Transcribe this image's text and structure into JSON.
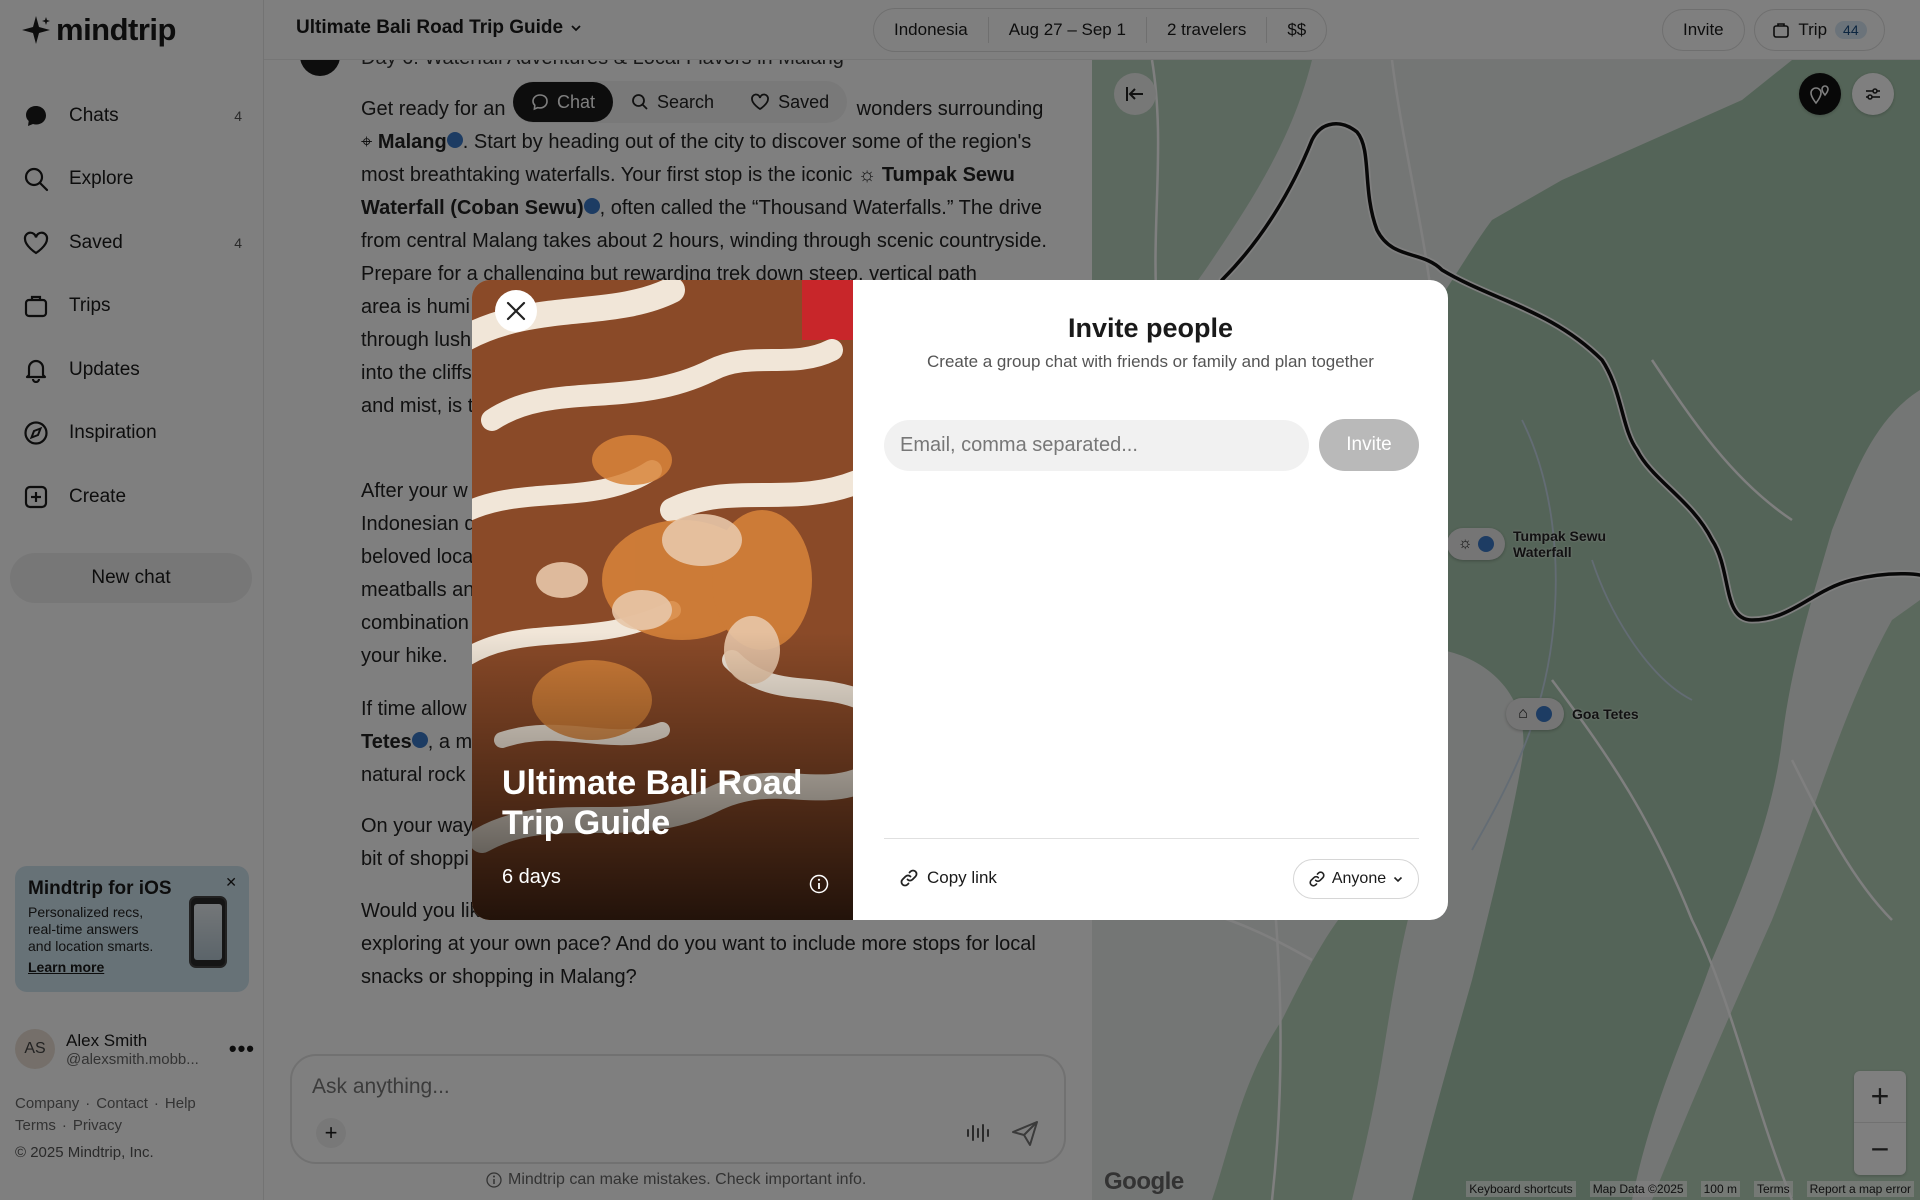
{
  "app": {
    "brand": "mindtrip"
  },
  "sidebar": {
    "items": [
      {
        "label": "Chats",
        "count": "4",
        "icon": "chat-bubble-icon"
      },
      {
        "label": "Explore",
        "count": "",
        "icon": "search-icon"
      },
      {
        "label": "Saved",
        "count": "4",
        "icon": "heart-icon"
      },
      {
        "label": "Trips",
        "count": "",
        "icon": "suitcase-icon"
      },
      {
        "label": "Updates",
        "count": "",
        "icon": "bell-icon"
      },
      {
        "label": "Inspiration",
        "count": "",
        "icon": "compass-icon"
      },
      {
        "label": "Create",
        "count": "",
        "icon": "plus-square-icon"
      }
    ],
    "new_chat": "New chat",
    "promo": {
      "title": "Mindtrip for iOS",
      "text": "Personalized recs, real-time answers and location smarts.",
      "link": "Learn more"
    },
    "user": {
      "initials": "AS",
      "name": "Alex Smith",
      "handle": "@alexsmith.mobb..."
    },
    "footer": {
      "company": "Company",
      "contact": "Contact",
      "help": "Help",
      "terms": "Terms",
      "privacy": "Privacy",
      "copyright": "© 2025 Mindtrip, Inc."
    }
  },
  "header": {
    "trip_title": "Ultimate Bali Road Trip Guide",
    "pills": [
      "Indonesia",
      "Aug 27 – Sep 1",
      "2 travelers",
      "$$"
    ],
    "invite": "Invite",
    "trip": "Trip",
    "trip_count": "44"
  },
  "chat": {
    "day_heading": "Day 6: Waterfall Adventures & Local Flavors in Malang",
    "tabs": [
      "Chat",
      "Search",
      "Saved"
    ],
    "p1_pre": "Get ready for an ",
    "p1_a": " wonders surrounding ",
    "p1_malang": "Malang",
    "p1_b": ". Start by heading out of the city to discover some of the region's most breathtaking waterfalls. Your first stop is the iconic ",
    "p1_tumpak": "Tumpak Sewu Waterfall (Coban Sewu)",
    "p1_c": ", often called the “Thousand Waterfalls.” The drive from central Malang takes about 2 hours, winding through scenic countryside. Prepare for a challenging but rewarding trek down steep, vertical path",
    "p1_d": "area is humi",
    "p1_e": "through lush",
    "p1_f": "into the cliffs",
    "p1_g": "and mist, is t",
    "p2_a": "After your w",
    "p2_b": "Indonesian d",
    "p2_c": "beloved loca",
    "p2_d": "meatballs an",
    "p2_e": "combination",
    "p2_f": "your hike.",
    "p3_a": "If time allow",
    "p3_b": "Tetes",
    "p3_c": ", a m",
    "p3_d": "natural rock",
    "p4_a": "On your way",
    "p4_b": "bit of shoppi",
    "p5_a": "Would you lik",
    "p5_b": "exploring at your own pace? And do you want to include more stops for local snacks or shopping in Malang?",
    "ask_placeholder": "Ask anything...",
    "disclaimer": "Mindtrip can make mistakes. Check important info."
  },
  "map": {
    "poi_1": "Tumpak Sewu Waterfall",
    "poi_2": "Goa Tetes",
    "footer": [
      "Keyboard shortcuts",
      "Map Data ©2025",
      "100 m",
      "Terms",
      "Report a map error"
    ],
    "google": "Google"
  },
  "modal": {
    "image_title": "Ultimate Bali Road Trip Guide",
    "image_days": "6 days",
    "title": "Invite people",
    "subtitle": "Create a group chat with friends or family and plan together",
    "email_placeholder": "Email, comma separated...",
    "invite_label": "Invite",
    "copy_link": "Copy link",
    "access": "Anyone"
  }
}
